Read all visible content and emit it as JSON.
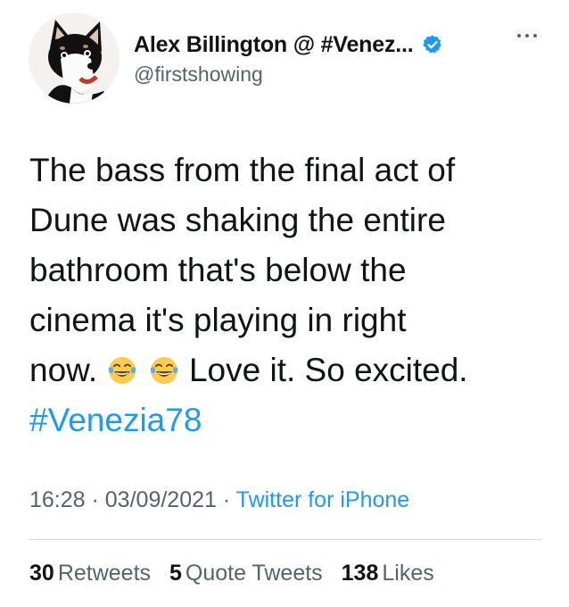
{
  "author": {
    "display_name": "Alex Billington @ #Venez...",
    "handle": "@firstshowing",
    "verified": true,
    "avatar_icon": "husky-dog-avatar"
  },
  "menu": {
    "more_icon": "more-horizontal-icon"
  },
  "tweet": {
    "line1": "The bass from the final act of",
    "line2": "Dune was shaking the entire",
    "line3": "bathroom that's below the",
    "line4": "cinema it's playing in right",
    "line5_start": "now.",
    "emoji": "tears-of-joy-emoji",
    "line5_end": "Love it. So excited.",
    "hashtag": "#Venezia78"
  },
  "meta": {
    "time": "16:28",
    "separator1": " · ",
    "date": "03/09/2021",
    "separator2": " · ",
    "source": "Twitter for iPhone"
  },
  "stats": {
    "retweets_count": "30",
    "retweets_label": "Retweets",
    "quotes_count": "5",
    "quotes_label": "Quote Tweets",
    "likes_count": "138",
    "likes_label": "Likes"
  },
  "colors": {
    "accent": "#1d9bf0",
    "text": "#0f1419",
    "secondary": "#536471",
    "divider": "#cfd9de"
  }
}
